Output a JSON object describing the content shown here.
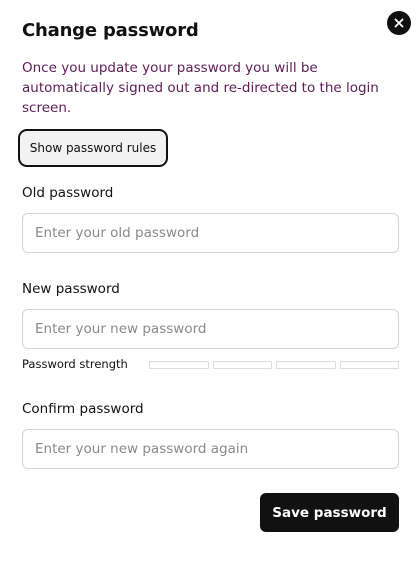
{
  "dialog": {
    "title": "Change password",
    "description": "Once you update your password you will be automatically signed out and re-directed to the login screen.",
    "close_icon": "close-icon",
    "rules_button_label": "Show password rules"
  },
  "fields": {
    "old_password": {
      "label": "Old password",
      "placeholder": "Enter your old password",
      "value": ""
    },
    "new_password": {
      "label": "New password",
      "placeholder": "Enter your new password",
      "value": ""
    },
    "confirm_password": {
      "label": "Confirm password",
      "placeholder": "Enter your new password again",
      "value": ""
    }
  },
  "strength": {
    "label": "Password strength",
    "segments": 4,
    "filled": 0
  },
  "actions": {
    "save_label": "Save password"
  },
  "colors": {
    "description_text": "#5c1d55",
    "primary_button": "#111111",
    "field_border": "#d4d4d4"
  }
}
